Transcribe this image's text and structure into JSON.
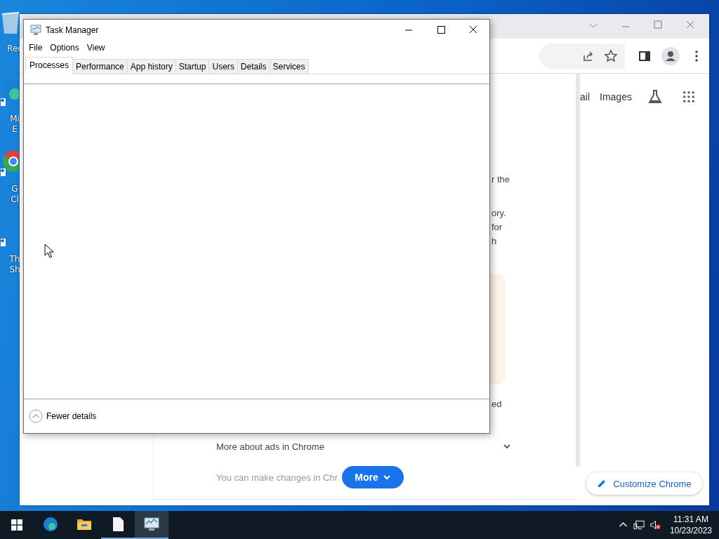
{
  "desktop_icons": [
    {
      "kind": "recycle-bin",
      "shortcut": false,
      "lines": [
        "Rec"
      ]
    },
    {
      "kind": "edge",
      "shortcut": true,
      "lines": [
        "Mi",
        "E"
      ]
    },
    {
      "kind": "chrome",
      "shortcut": true,
      "lines": [
        "G",
        "Cl"
      ]
    },
    {
      "kind": "blank",
      "shortcut": true,
      "lines": [
        "Th",
        "Sh"
      ]
    }
  ],
  "browser": {
    "page": {
      "text_fragments": [
        {
          "lines": [
            "r the"
          ]
        },
        {
          "lines": [
            "ory.",
            "for",
            "h"
          ]
        },
        {
          "lines": [
            "ed"
          ]
        }
      ],
      "ads_row": {
        "label": "More about ads in Chrome",
        "expanded": false
      },
      "note": "You can make changes in Chr",
      "more_button": "More",
      "header_links": [
        "ail",
        "Images"
      ],
      "customize_button": "Customize Chrome"
    }
  },
  "task_manager": {
    "title": "Task Manager",
    "menu": [
      "File",
      "Options",
      "View"
    ],
    "tabs": [
      {
        "label": "Processes",
        "selected": true
      },
      {
        "label": "Performance",
        "selected": false
      },
      {
        "label": "App history",
        "selected": false
      },
      {
        "label": "Startup",
        "selected": false
      },
      {
        "label": "Users",
        "selected": false
      },
      {
        "label": "Details",
        "selected": false
      },
      {
        "label": "Services",
        "selected": false
      }
    ],
    "footer": "Fewer details"
  },
  "taskbar": {
    "apps": [
      {
        "kind": "edge",
        "running": false,
        "active": false
      },
      {
        "kind": "folder",
        "running": false,
        "active": false
      },
      {
        "kind": "document",
        "running": true,
        "active": false
      },
      {
        "kind": "task-manager",
        "running": true,
        "active": true
      }
    ],
    "time": "11:31 AM",
    "date": "10/23/2023"
  }
}
